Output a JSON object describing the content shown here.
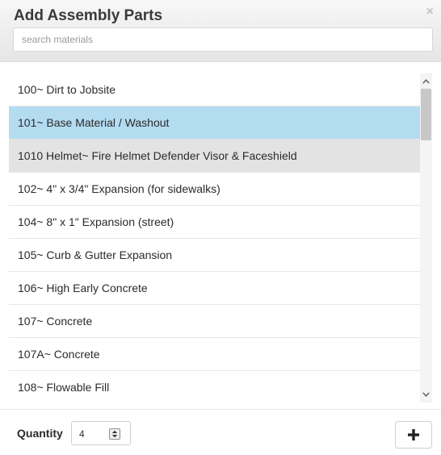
{
  "header": {
    "title": "Add Assembly Parts",
    "close_icon": "close-icon",
    "close_glyph": "×"
  },
  "search": {
    "placeholder": "search materials",
    "value": ""
  },
  "materials": {
    "items": [
      {
        "label": "100~ Dirt to Jobsite",
        "state": "normal"
      },
      {
        "label": "101~ Base Material / Washout",
        "state": "selected"
      },
      {
        "label": "1010 Helmet~ Fire Helmet Defender Visor & Faceshield",
        "state": "hover"
      },
      {
        "label": "102~ 4\" x 3/4\" Expansion (for sidewalks)",
        "state": "normal"
      },
      {
        "label": "104~ 8\" x 1\" Expansion (street)",
        "state": "normal"
      },
      {
        "label": "105~ Curb & Gutter Expansion",
        "state": "normal"
      },
      {
        "label": "106~ High Early Concrete",
        "state": "normal"
      },
      {
        "label": "107~ Concrete",
        "state": "normal"
      },
      {
        "label": "107A~ Concrete",
        "state": "normal"
      },
      {
        "label": "108~ Flowable Fill",
        "state": "normal"
      }
    ],
    "scrollbar": {
      "up_icon": "chevron-up-icon",
      "down_icon": "chevron-down-icon"
    }
  },
  "footer": {
    "quantity_label": "Quantity",
    "quantity_value": "4",
    "spinner_icon": "spinner-arrows-icon",
    "add_icon": "plus-icon"
  },
  "colors": {
    "selected_row": "#b3dcf1",
    "hover_row": "#e3e3e3",
    "header_bg": "#eeeeee"
  }
}
